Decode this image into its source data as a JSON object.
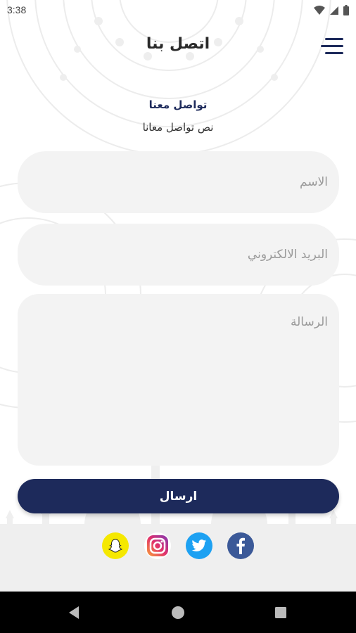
{
  "status_bar": {
    "time": "3:38",
    "icons": [
      "wifi-icon",
      "signal-icon",
      "battery-icon"
    ]
  },
  "header": {
    "title": "اتصل بنا",
    "menu_icon": "menu-icon"
  },
  "intro": {
    "title": "تواصل معنا",
    "text": "نص تواصل معانا"
  },
  "form": {
    "name_placeholder": "الاسم",
    "email_placeholder": "البريد الالكتروني",
    "message_placeholder": "الرسالة",
    "send_label": "ارسال"
  },
  "social": {
    "links": [
      "facebook-icon",
      "twitter-icon",
      "instagram-icon",
      "snapchat-icon"
    ]
  },
  "nav": {
    "buttons": [
      "back-icon",
      "home-icon",
      "recents-icon"
    ]
  },
  "colors": {
    "primary": "#1d2a5b",
    "field_bg": "#f3f3f3",
    "placeholder": "#9a9a9a",
    "snapchat": "#f5e800",
    "twitter": "#1da1f2",
    "facebook": "#3b5998",
    "nav_bar": "#000000"
  }
}
